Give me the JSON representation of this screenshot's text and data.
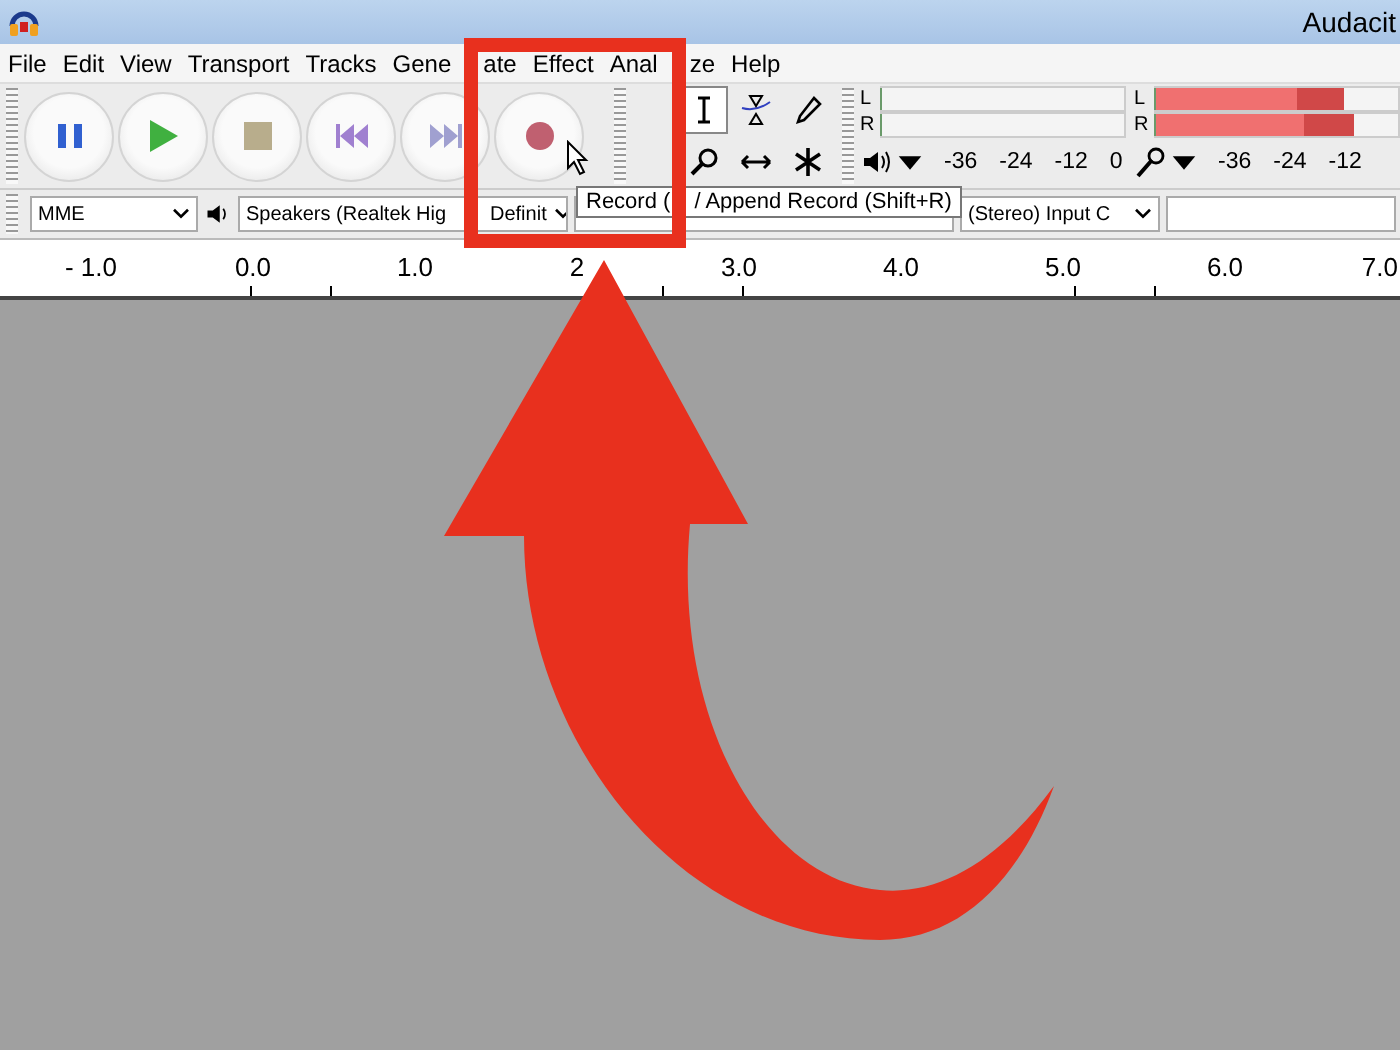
{
  "window": {
    "title": "Audacit"
  },
  "menu": [
    {
      "parts": [
        "File"
      ]
    },
    {
      "parts": [
        "Edit"
      ]
    },
    {
      "parts": [
        "View"
      ]
    },
    {
      "parts": [
        "Transport"
      ]
    },
    {
      "parts": [
        "Tracks"
      ]
    },
    {
      "parts": [
        "Gene",
        "ate"
      ]
    },
    {
      "parts": [
        "Effect"
      ]
    },
    {
      "parts": [
        "Anal",
        "ze"
      ]
    },
    {
      "parts": [
        "Help"
      ]
    }
  ],
  "transport": [
    {
      "kind": "pause"
    },
    {
      "kind": "play"
    },
    {
      "kind": "stop"
    },
    {
      "kind": "skip-start"
    },
    {
      "kind": "skip-end"
    },
    {
      "kind": "record"
    }
  ],
  "tools": [
    {
      "kind": "select",
      "selected": true
    },
    {
      "kind": "envelope",
      "selected": false
    },
    {
      "kind": "draw",
      "selected": false
    },
    {
      "kind": "zoom",
      "selected": false
    },
    {
      "kind": "timeshift",
      "selected": false
    },
    {
      "kind": "multi",
      "selected": false
    }
  ],
  "meters": [
    {
      "kind": "playback",
      "channels": [
        {
          "label": "L",
          "level": 0
        },
        {
          "label": "R",
          "level": 0
        }
      ],
      "scale": [
        "-36",
        "-24",
        "-12",
        "0"
      ]
    },
    {
      "kind": "recording",
      "channels": [
        {
          "label": "L",
          "level": 0.78
        },
        {
          "label": "R",
          "level": 0.82
        }
      ],
      "scale": [
        "-36",
        "-24",
        "-12"
      ]
    }
  ],
  "device": {
    "host": "MME",
    "output": "Speakers (Realtek Hig",
    "output_rate": "Definit",
    "input": "(Stereo) Input C"
  },
  "tooltip": {
    "parts": [
      "Record (",
      "/ Append Record (Shift+R)"
    ]
  },
  "ruler": [
    "- 1.0",
    "0.0",
    "1.0",
    "2",
    "3.0",
    "4.0",
    "5.0",
    "6.0",
    "7.0"
  ]
}
